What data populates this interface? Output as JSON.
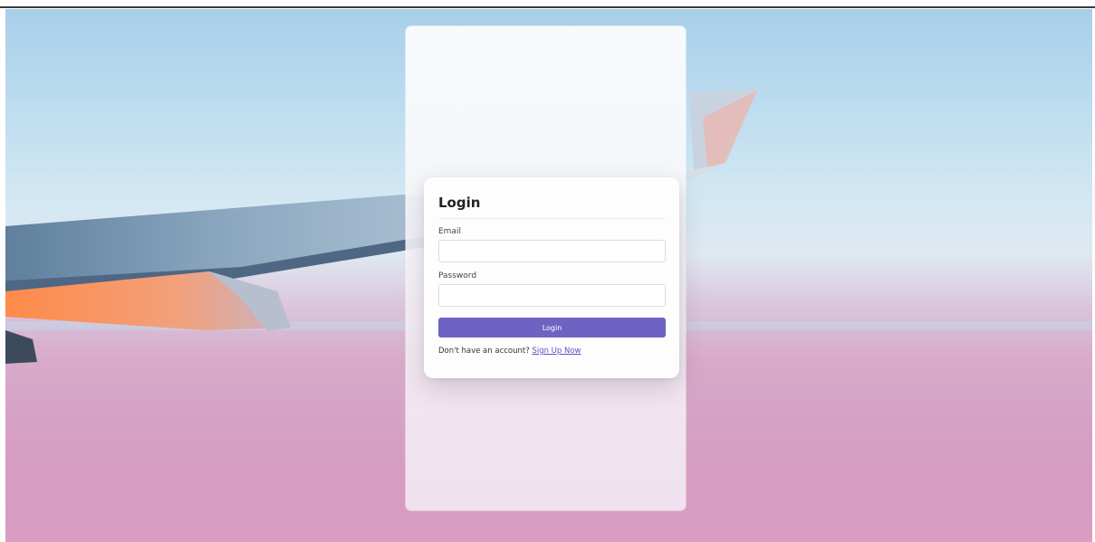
{
  "login": {
    "title": "Login",
    "email_label": "Email",
    "email_value": "",
    "password_label": "Password",
    "password_value": "",
    "button_label": "Login",
    "signup_prompt": "Don't have an account?",
    "signup_link": "Sign Up Now"
  },
  "colors": {
    "accent": "#6e63c2",
    "link": "#5b4fc4"
  }
}
